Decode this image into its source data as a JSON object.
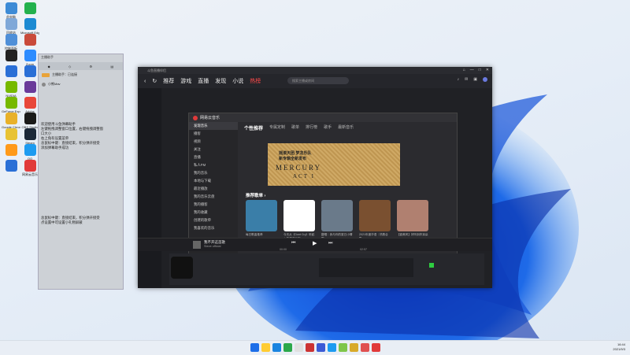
{
  "desktop": {
    "icons": [
      {
        "label": "此电脑",
        "color": "#3d8bd6"
      },
      {
        "label": "",
        "color": "#23b14d"
      },
      {
        "label": "回收站",
        "color": "#7fa8d8"
      },
      {
        "label": "Microsoft Edge",
        "color": "#1c8ad2"
      },
      {
        "label": "控制面板",
        "color": "#4f8fd8"
      },
      {
        "label": "",
        "color": "#c94a3a"
      },
      {
        "label": "",
        "color": "#222222"
      },
      {
        "label": "Zoom",
        "color": "#2d8cff"
      },
      {
        "label": "",
        "color": "#2a6fd6"
      },
      {
        "label": "",
        "color": "#2a6fd6"
      },
      {
        "label": "NVIDIA",
        "color": "#76b900"
      },
      {
        "label": "",
        "color": "#6a3a9a"
      },
      {
        "label": "GeForce Experience",
        "color": "#76b900"
      },
      {
        "label": "Adobe",
        "color": "#e8473a"
      },
      {
        "label": "Google Chrome",
        "color": "#e8b12a"
      },
      {
        "label": "OBS Studio",
        "color": "#1a1a1a"
      },
      {
        "label": "",
        "color": "#e8c334"
      },
      {
        "label": "Steam",
        "color": "#1b2838"
      },
      {
        "label": "",
        "color": "#ff9a1a"
      },
      {
        "label": "QQ",
        "color": "#1d9bf0"
      },
      {
        "label": "",
        "color": "#2a6fd6"
      },
      {
        "label": "网易云音乐",
        "color": "#e13a3a"
      }
    ]
  },
  "side_panel": {
    "header": "主播助手",
    "tabs": [
      "◆",
      "◇",
      "⚙",
      "▤"
    ],
    "rows": [
      "主播助手：已连接",
      "小熊Mav"
    ],
    "notes": [
      "欢迎使用斗鱼弹幕助手",
      "左键拖拽调整窗口位置，右键拖拽调整窗",
      "口大小",
      "右上角有设置菜单",
      "总鼠标中键：直接结束，积分弹开接受",
      "添加弹幕助手成功"
    ],
    "note2": [
      "总鼠标中键：直接结束，积分弹开接受",
      "点设置中可设置小礼物屏蔽"
    ]
  },
  "browser": {
    "title": "斗鱼直播伴侣",
    "nav": [
      "推荐",
      "游戏",
      "直播",
      "发现",
      "小说",
      "热榜"
    ],
    "active_nav": "热榜",
    "search_placeholder": "搜索主播或房间",
    "win_controls": [
      "⌂",
      "—",
      "□",
      "✕"
    ]
  },
  "music": {
    "app_title": "网易云音乐",
    "sidebar": [
      "发现音乐",
      "播客",
      "视频",
      "关注",
      "直播",
      "私人FM",
      "我的音乐",
      "本地与下载",
      "最近播放",
      "我的音乐云盘",
      "我的播客",
      "我的收藏",
      "创建的歌单",
      "我喜欢的音乐"
    ],
    "selected": "发现音乐",
    "tabs": [
      "个性推荐",
      "专属定制",
      "歌单",
      "排行榜",
      "歌手",
      "最新音乐"
    ],
    "active_tab": "个性推荐",
    "banner": {
      "line1": "摇滚天团 梦龙乐队",
      "line2": "新专辑全新发布",
      "title": "MERCURY",
      "sub": "ACT I"
    },
    "section_title": "推荐歌单 ›",
    "playlists": [
      {
        "title": "每日歌曲推荐",
        "color": "#3a7ea8"
      },
      {
        "title": "今天从《Dont Cry》听起｜华语流行向",
        "color": "#ffffff"
      },
      {
        "title": "翻唱｜我与你的夏日小情歌",
        "color": "#6a7a8a"
      },
      {
        "title": "2021年度华语｜热歌合集",
        "color": "#7a5030"
      },
      {
        "title": "【欧美风】好听到炸耳朵",
        "color": "#b08070"
      }
    ],
    "player": {
      "song": "我不开这首歌",
      "artist": "Steve official",
      "time_left": "00:00",
      "time_right": "02:57"
    }
  },
  "taskbar": {
    "icons": [
      "#1d6ee8",
      "#ffcc33",
      "#1a84e0",
      "#2ba84a",
      "#e0e0e0",
      "#cc3333",
      "#3b5bd6",
      "#1d9bf0",
      "#7fc64a",
      "#d8aa2a",
      "#e05050",
      "#e13a3a"
    ],
    "time": "16:44",
    "date": "2021/9/3"
  }
}
